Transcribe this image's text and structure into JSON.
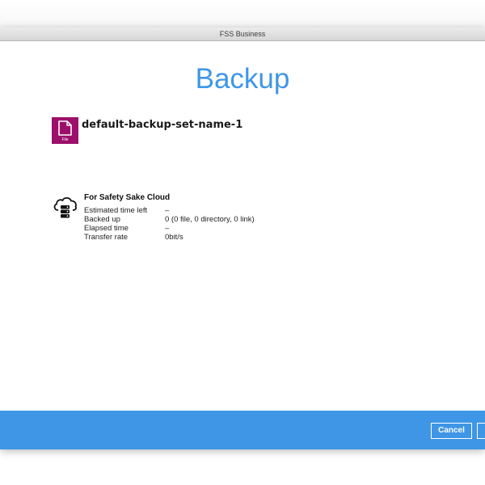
{
  "window": {
    "title": "FSS Business"
  },
  "page": {
    "heading": "Backup"
  },
  "backup_set": {
    "name": "default-backup-set-name-1",
    "icon": "file-document-icon",
    "icon_badge": "File",
    "icon_color": "#9c0f6b"
  },
  "destination": {
    "name": "For Safety Sake Cloud",
    "icon": "cloud-server-icon",
    "stats": [
      {
        "label": "Estimated time left",
        "value": "–"
      },
      {
        "label": "Backed up",
        "value": "0 (0 file, 0 directory, 0 link)"
      },
      {
        "label": "Elapsed time",
        "value": "–"
      },
      {
        "label": "Transfer rate",
        "value": "0bit/s"
      }
    ]
  },
  "footer": {
    "cancel_label": "Cancel",
    "accent": "#3f96e6"
  }
}
